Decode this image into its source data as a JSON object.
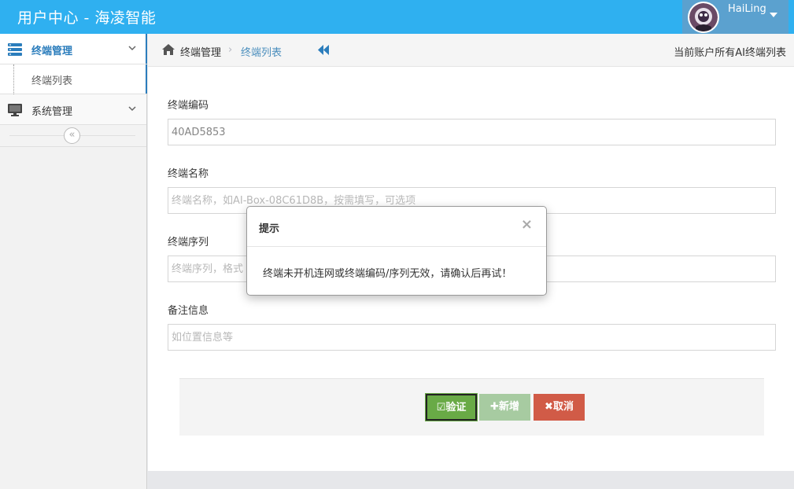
{
  "app": {
    "title": "用户中心 - 海凌智能",
    "user_name": "HaiLing"
  },
  "sidebar": {
    "items": [
      {
        "label": "终端管理",
        "icon": "server-icon"
      },
      {
        "label": "终端列表"
      },
      {
        "label": "系统管理",
        "icon": "desktop-icon"
      }
    ],
    "collapse_glyph": "«"
  },
  "breadcrumb": {
    "home": "终端管理",
    "separator": "›",
    "current": "终端列表",
    "right_text": "当前账户所有AI终端列表"
  },
  "form": {
    "code": {
      "label": "终端编码",
      "value": "40AD5853",
      "placeholder": ""
    },
    "name": {
      "label": "终端名称",
      "value": "",
      "placeholder": "终端名称，如AI-Box-08C61D8B，按需填写，可选项"
    },
    "serial": {
      "label": "终端序列",
      "value": "",
      "placeholder": "终端序列，格式"
    },
    "remark": {
      "label": "备注信息",
      "value": "",
      "placeholder": "如位置信息等"
    }
  },
  "actions": {
    "verify": "☑验证",
    "add": "✚新增",
    "cancel": "✖取消"
  },
  "modal": {
    "title": "提示",
    "close": "×",
    "message": "终端未开机连网或终端编码/序列无效，请确认后再试！"
  },
  "colors": {
    "navbar": "#2fb0f0",
    "accent": "#2b7dbc",
    "verify": "#69aa46",
    "add": "#a7cba1",
    "cancel": "#d15b47"
  }
}
